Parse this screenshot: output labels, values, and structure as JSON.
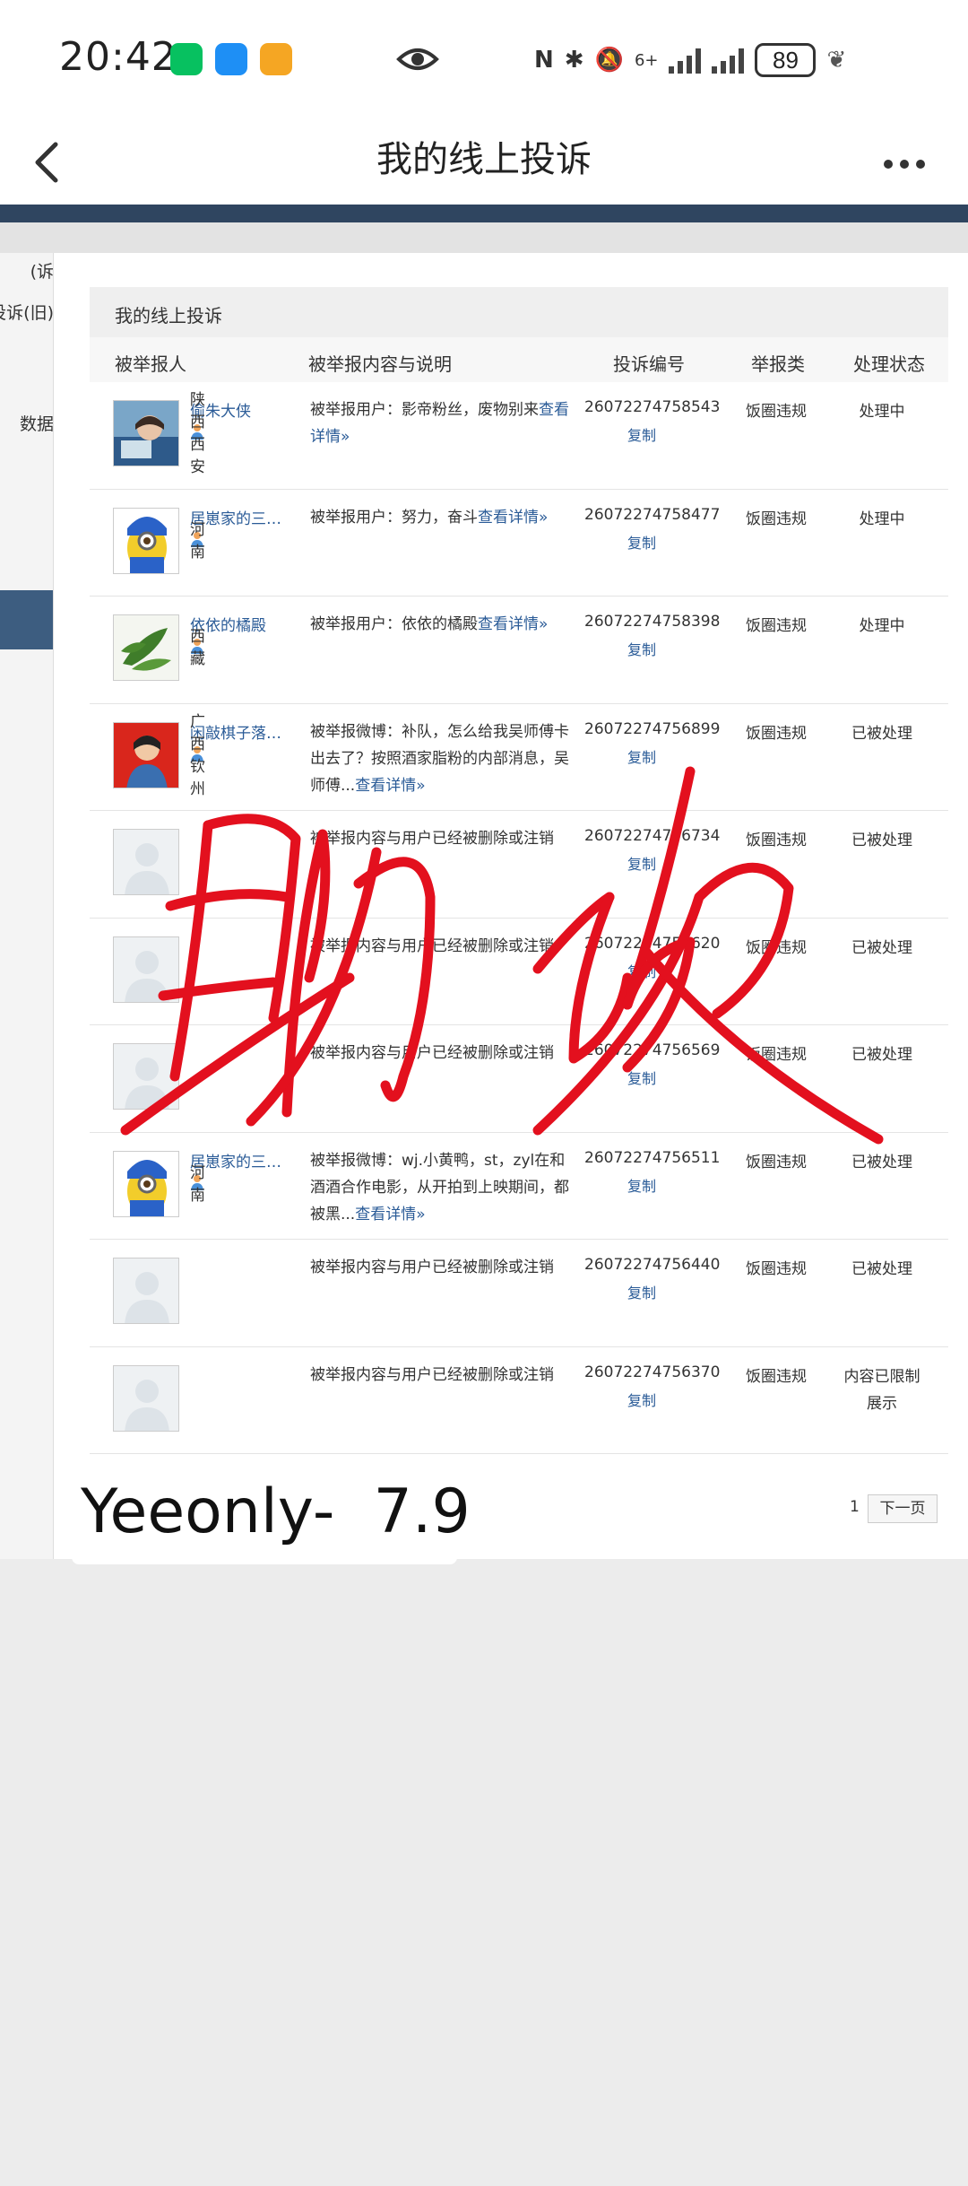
{
  "status_bar": {
    "time": "20:42",
    "battery": "89",
    "network": "6+",
    "app_icons": [
      {
        "name": "wechat-icon",
        "color": "#07c160"
      },
      {
        "name": "message-icon",
        "color": "#1e8ff5"
      },
      {
        "name": "notes-app-icon",
        "color": "#f5a623"
      }
    ]
  },
  "nav": {
    "title": "我的线上投诉"
  },
  "sidebar": {
    "items": [
      {
        "label": "诉)"
      },
      {
        "label": "投诉(旧)"
      },
      {
        "label": "数据"
      }
    ]
  },
  "section_title": "我的线上投诉",
  "table": {
    "headers": {
      "reported": "被举报人",
      "content": "被举报内容与说明",
      "number": "投诉编号",
      "category": "举报类",
      "status": "处理状态"
    },
    "rows": [
      {
        "name": "偷朱大侠",
        "location": "陕西 西安",
        "avatar": "photo",
        "desc": "被举报用户：影帝粉丝，废物别来",
        "more": "查看详情»",
        "number": "26072274758543",
        "copy": "复制",
        "category": "饭圈违规",
        "status": "处理中"
      },
      {
        "name": "居崽家的三只猫",
        "location": "河南",
        "avatar": "minion",
        "desc": "被举报用户：努力，奋斗",
        "more": "查看详情»",
        "number": "26072274758477",
        "copy": "复制",
        "category": "饭圈违规",
        "status": "处理中"
      },
      {
        "name": "依依的橘殿",
        "location": "西藏",
        "avatar": "leaf",
        "desc": "被举报用户：依依的橘殿",
        "more": "查看详情»",
        "number": "26072274758398",
        "copy": "复制",
        "category": "饭圈违规",
        "status": "处理中"
      },
      {
        "name": "闲敲棋子落呱...",
        "location": "广西 钦州",
        "avatar": "poster",
        "desc": "被举报微博：补队，怎么给我吴师傅卡出去了？按照酒家脂粉的内部消息，吴师傅...",
        "more": "查看详情»",
        "number": "26072274756899",
        "copy": "复制",
        "category": "饭圈违规",
        "status": "已被处理"
      },
      {
        "name": "",
        "location": "",
        "avatar": "blank",
        "desc": "被举报内容与用户已经被删除或注销",
        "more": "",
        "number": "26072274756734",
        "copy": "复制",
        "category": "饭圈违规",
        "status": "已被处理"
      },
      {
        "name": "",
        "location": "",
        "avatar": "blank",
        "desc": "被举报内容与用户已经被删除或注销",
        "more": "",
        "number": "26072274756620",
        "copy": "复制",
        "category": "饭圈违规",
        "status": "已被处理"
      },
      {
        "name": "",
        "location": "",
        "avatar": "blank",
        "desc": "被举报内容与用户已经被删除或注销",
        "more": "",
        "number": "26072274756569",
        "copy": "复制",
        "category": "饭圈违规",
        "status": "已被处理"
      },
      {
        "name": "居崽家的三只猫",
        "location": "河南",
        "avatar": "minion",
        "desc": "被举报微博：wj.小黄鸭，st，zyl在和酒酒合作电影，从开拍到上映期间，都被黑...",
        "more": "查看详情»",
        "number": "26072274756511",
        "copy": "复制",
        "category": "饭圈违规",
        "status": "已被处理"
      },
      {
        "name": "",
        "location": "",
        "avatar": "blank",
        "desc": "被举报内容与用户已经被删除或注销",
        "more": "",
        "number": "26072274756440",
        "copy": "复制",
        "category": "饭圈违规",
        "status": "已被处理"
      },
      {
        "name": "",
        "location": "",
        "avatar": "blank",
        "desc": "被举报内容与用户已经被删除或注销",
        "more": "",
        "number": "26072274756370",
        "copy": "复制",
        "category": "饭圈违规",
        "status": "内容已限制展示"
      }
    ]
  },
  "pager": {
    "page": "1",
    "next": "下一页"
  },
  "watermark": "Yeeonly-  7.9",
  "colors": {
    "link": "#2a5b97",
    "header_band": "#2f4560",
    "scribble": "#e3101e"
  }
}
